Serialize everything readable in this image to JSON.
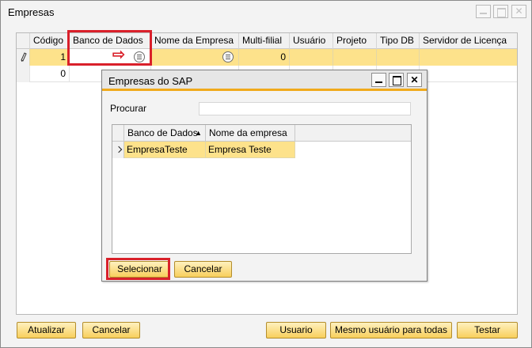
{
  "window": {
    "title": "Empresas",
    "close_glyph": "✕"
  },
  "grid": {
    "columns": [
      "Código",
      "Banco de Dados",
      "Nome da Empresa",
      "Multi-filial",
      "Usuário",
      "Projeto",
      "Tipo DB",
      "Servidor de Licença"
    ],
    "rows": [
      {
        "codigo": "1",
        "banco": "",
        "nome": "",
        "multi": "0"
      },
      {
        "codigo": "0"
      }
    ]
  },
  "annotation": {
    "arrow_glyph": "⇨",
    "highlight_color": "#d9202a"
  },
  "dialog": {
    "title": "Empresas do SAP",
    "close_glyph": "✕",
    "search_label": "Procurar",
    "search_value": "",
    "columns": [
      "Banco de Dados",
      "Nome da empresa"
    ],
    "sort_glyph": "▲",
    "rows": [
      {
        "banco": "EmpresaTeste",
        "nome": "Empresa Teste"
      }
    ],
    "select_label": "Selecionar",
    "cancel_label": "Cancelar"
  },
  "footer": {
    "update_label": "Atualizar",
    "cancel_label": "Cancelar",
    "user_label": "Usuario",
    "same_user_label": "Mesmo usuário para todas",
    "test_label": "Testar"
  },
  "colors": {
    "selected_row": "#fde28b",
    "accent": "#f0aa1b"
  }
}
